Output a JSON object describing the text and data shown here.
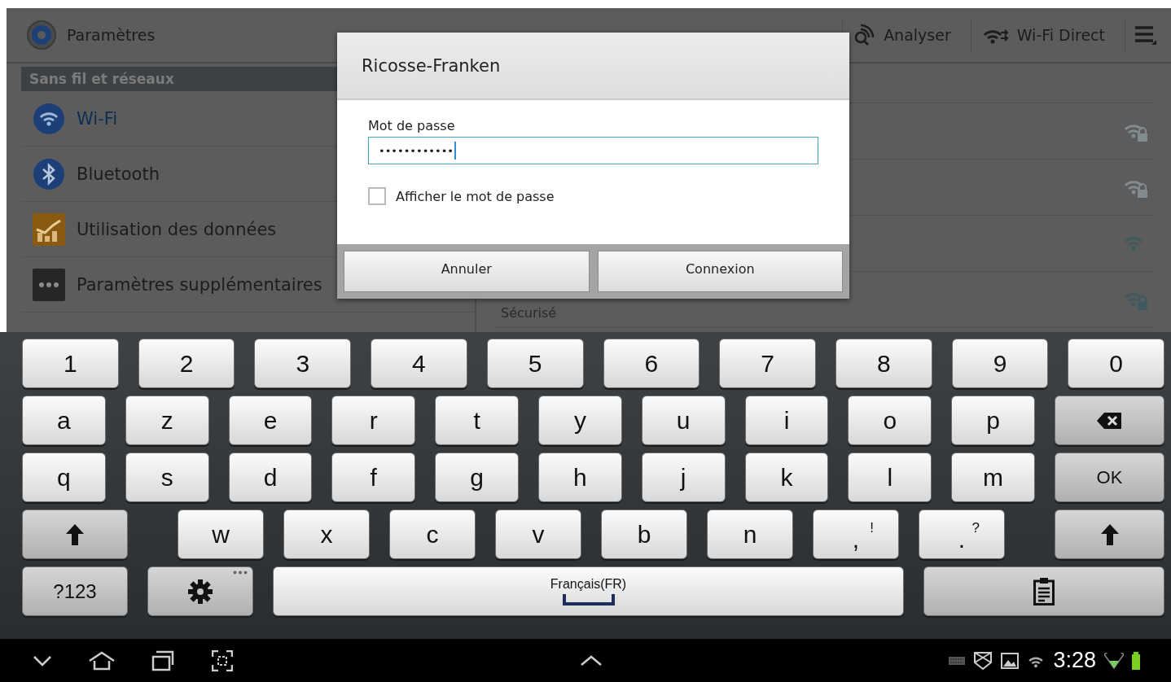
{
  "action_bar": {
    "title": "Paramètres",
    "actions": [
      {
        "kind": "scan",
        "label": "Analyser"
      },
      {
        "kind": "wifi-direct",
        "label": "Wi-Fi Direct"
      }
    ]
  },
  "sidebar": {
    "header": "Sans fil et réseaux",
    "items": [
      {
        "kind": "wifi",
        "label": "Wi-Fi",
        "selected": true
      },
      {
        "kind": "bluetooth",
        "label": "Bluetooth",
        "selected": false
      },
      {
        "kind": "data",
        "label": "Utilisation des données",
        "selected": false
      },
      {
        "kind": "more",
        "label": "Paramètres supplémentaires",
        "selected": false
      }
    ]
  },
  "networks": [
    {
      "locked": true,
      "weak": true
    },
    {
      "locked": true,
      "weak": true
    },
    {
      "locked": false,
      "weak": false
    },
    {
      "locked": true,
      "weak": false,
      "subtitle": "Sécurisé"
    }
  ],
  "dialog": {
    "title": "Ricosse-Franken",
    "field_label": "Mot de passe",
    "value": "••••••••••••",
    "checkbox": {
      "label": "Afficher le mot de passe",
      "checked": false
    },
    "buttons": [
      "Annuler",
      "Connexion"
    ]
  },
  "keyboard": {
    "rows": [
      {
        "keys": [
          {
            "kind": "char",
            "label": "1"
          },
          {
            "kind": "char",
            "label": "2"
          },
          {
            "kind": "char",
            "label": "3"
          },
          {
            "kind": "char",
            "label": "4"
          },
          {
            "kind": "char",
            "label": "5"
          },
          {
            "kind": "char",
            "label": "6"
          },
          {
            "kind": "char",
            "label": "7"
          },
          {
            "kind": "char",
            "label": "8"
          },
          {
            "kind": "char",
            "label": "9"
          },
          {
            "kind": "char",
            "label": "0"
          }
        ]
      },
      {
        "keys": [
          {
            "kind": "char",
            "label": "a"
          },
          {
            "kind": "char",
            "label": "z"
          },
          {
            "kind": "char",
            "label": "e"
          },
          {
            "kind": "char",
            "label": "r"
          },
          {
            "kind": "char",
            "label": "t"
          },
          {
            "kind": "char",
            "label": "y"
          },
          {
            "kind": "char",
            "label": "u"
          },
          {
            "kind": "char",
            "label": "i"
          },
          {
            "kind": "char",
            "label": "o"
          },
          {
            "kind": "char",
            "label": "p"
          },
          {
            "kind": "backspace"
          }
        ]
      },
      {
        "keys": [
          {
            "kind": "char",
            "label": "q"
          },
          {
            "kind": "char",
            "label": "s"
          },
          {
            "kind": "char",
            "label": "d"
          },
          {
            "kind": "char",
            "label": "f"
          },
          {
            "kind": "char",
            "label": "g"
          },
          {
            "kind": "char",
            "label": "h"
          },
          {
            "kind": "char",
            "label": "j"
          },
          {
            "kind": "char",
            "label": "k"
          },
          {
            "kind": "char",
            "label": "l"
          },
          {
            "kind": "char",
            "label": "m"
          },
          {
            "kind": "ok",
            "label": "OK"
          }
        ]
      },
      {
        "keys": [
          {
            "kind": "shift"
          },
          {
            "kind": "char",
            "label": "w"
          },
          {
            "kind": "char",
            "label": "x"
          },
          {
            "kind": "char",
            "label": "c"
          },
          {
            "kind": "char",
            "label": "v"
          },
          {
            "kind": "char",
            "label": "b"
          },
          {
            "kind": "char",
            "label": "n"
          },
          {
            "kind": "punct",
            "label": ",",
            "alt": "!"
          },
          {
            "kind": "punct",
            "label": ".",
            "alt": "?"
          },
          {
            "kind": "shift"
          }
        ]
      },
      {
        "keys": [
          {
            "kind": "symbols",
            "label": "?123"
          },
          {
            "kind": "settings"
          },
          {
            "kind": "space",
            "label": "Français(FR)"
          },
          {
            "kind": "clipboard"
          }
        ]
      }
    ]
  },
  "status_bar": {
    "time": "3:28"
  }
}
